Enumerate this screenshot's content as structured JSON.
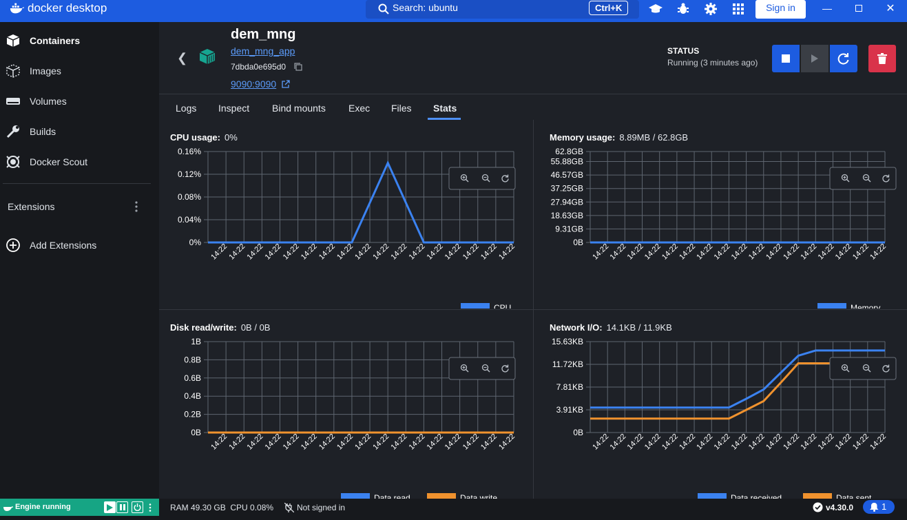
{
  "app": {
    "title": "docker desktop"
  },
  "search": {
    "placeholder": "Search: ubuntu",
    "shortcut": "Ctrl+K"
  },
  "titlebar": {
    "signin_label": "Sign in"
  },
  "sidebar": {
    "items": [
      {
        "label": "Containers",
        "icon": "containers-icon"
      },
      {
        "label": "Images",
        "icon": "images-icon"
      },
      {
        "label": "Volumes",
        "icon": "volumes-icon"
      },
      {
        "label": "Builds",
        "icon": "builds-icon"
      },
      {
        "label": "Docker Scout",
        "icon": "scout-icon"
      }
    ],
    "extensions_label": "Extensions",
    "add_extensions_label": "Add Extensions"
  },
  "container": {
    "name": "dem_mng",
    "app": "dem_mng_app",
    "id": "7dbda0e695d0",
    "port": "9090:9090",
    "status_label": "STATUS",
    "status_value": "Running (3 minutes ago)"
  },
  "tabs": [
    "Logs",
    "Inspect",
    "Bind mounts",
    "Exec",
    "Files",
    "Stats"
  ],
  "active_tab": "Stats",
  "colors": {
    "accent": "#1d5ce0",
    "series_blue": "#3b82f0",
    "series_orange": "#f0922e",
    "delete": "#d9334a",
    "engine": "#16a584"
  },
  "stats": {
    "cpu": {
      "label": "CPU usage:",
      "value": "0%"
    },
    "memory": {
      "label": "Memory usage:",
      "value": "8.89MB / 62.8GB"
    },
    "disk": {
      "label": "Disk read/write:",
      "value": "0B / 0B"
    },
    "network": {
      "label": "Network I/O:",
      "value": "14.1KB / 11.9KB"
    }
  },
  "chart_data": [
    {
      "type": "line",
      "title": "CPU usage:",
      "x": [
        "14:22",
        "14:22",
        "14:22",
        "14:22",
        "14:22",
        "14:22",
        "14:22",
        "14:22",
        "14:22",
        "14:22",
        "14:22",
        "14:22",
        "14:22",
        "14:22",
        "14:22",
        "14:22",
        "14:22"
      ],
      "yticks": [
        "0%",
        "0.04%",
        "0.08%",
        "0.12%",
        "0.16%"
      ],
      "ylim": [
        0,
        0.16
      ],
      "series": [
        {
          "name": "CPU",
          "values": [
            0,
            0,
            0,
            0,
            0,
            0,
            0,
            0,
            0,
            0.07,
            0.14,
            0.07,
            0,
            0,
            0,
            0,
            0,
            0
          ]
        }
      ]
    },
    {
      "type": "line",
      "title": "Memory usage:",
      "x": [
        "14:22",
        "14:22",
        "14:22",
        "14:22",
        "14:22",
        "14:22",
        "14:22",
        "14:22",
        "14:22",
        "14:22",
        "14:22",
        "14:22",
        "14:22",
        "14:22",
        "14:22",
        "14:22",
        "14:22"
      ],
      "yticks": [
        "0B",
        "9.31GB",
        "18.63GB",
        "27.94GB",
        "37.25GB",
        "46.57GB",
        "55.88GB",
        "62.8GB"
      ],
      "ylim": [
        0,
        62.8
      ],
      "series": [
        {
          "name": "Memory",
          "values": [
            0,
            0,
            0,
            0,
            0,
            0,
            0,
            0,
            0,
            0,
            0,
            0,
            0,
            0,
            0,
            0,
            0,
            0
          ]
        }
      ]
    },
    {
      "type": "line",
      "title": "Disk read/write:",
      "x": [
        "14:22",
        "14:22",
        "14:22",
        "14:22",
        "14:22",
        "14:22",
        "14:22",
        "14:22",
        "14:22",
        "14:22",
        "14:22",
        "14:22",
        "14:22",
        "14:22",
        "14:22",
        "14:22",
        "14:22"
      ],
      "yticks": [
        "0B",
        "0.2B",
        "0.4B",
        "0.6B",
        "0.8B",
        "1B"
      ],
      "ylim": [
        0,
        1
      ],
      "series": [
        {
          "name": "Data read",
          "values": [
            0,
            0,
            0,
            0,
            0,
            0,
            0,
            0,
            0,
            0,
            0,
            0,
            0,
            0,
            0,
            0,
            0,
            0
          ]
        },
        {
          "name": "Data write",
          "values": [
            0,
            0,
            0,
            0,
            0,
            0,
            0,
            0,
            0,
            0,
            0,
            0,
            0,
            0,
            0,
            0,
            0,
            0
          ]
        }
      ]
    },
    {
      "type": "line",
      "title": "Network I/O:",
      "x": [
        "14:22",
        "14:22",
        "14:22",
        "14:22",
        "14:22",
        "14:22",
        "14:22",
        "14:22",
        "14:22",
        "14:22",
        "14:22",
        "14:22",
        "14:22",
        "14:22",
        "14:22",
        "14:22",
        "14:22"
      ],
      "yticks": [
        "0B",
        "3.91KB",
        "7.81KB",
        "11.72KB",
        "15.63KB"
      ],
      "ylim": [
        0,
        15.63
      ],
      "series": [
        {
          "name": "Data received",
          "values": [
            4.3,
            4.3,
            4.3,
            4.3,
            4.3,
            4.3,
            4.3,
            4.3,
            4.3,
            5.8,
            7.4,
            10.3,
            13.2,
            14.1,
            14.1,
            14.1,
            14.1,
            14.1
          ]
        },
        {
          "name": "Data sent",
          "values": [
            2.4,
            2.4,
            2.4,
            2.4,
            2.4,
            2.4,
            2.4,
            2.4,
            2.4,
            3.9,
            5.4,
            8.6,
            11.9,
            11.9,
            11.9,
            11.9,
            11.9,
            11.9
          ]
        }
      ]
    }
  ],
  "statusbar": {
    "engine": "Engine running",
    "ram": "RAM 49.30 GB",
    "cpu": "CPU 0.08%",
    "signin": "Not signed in",
    "version": "v4.30.0",
    "notifications": "1"
  }
}
